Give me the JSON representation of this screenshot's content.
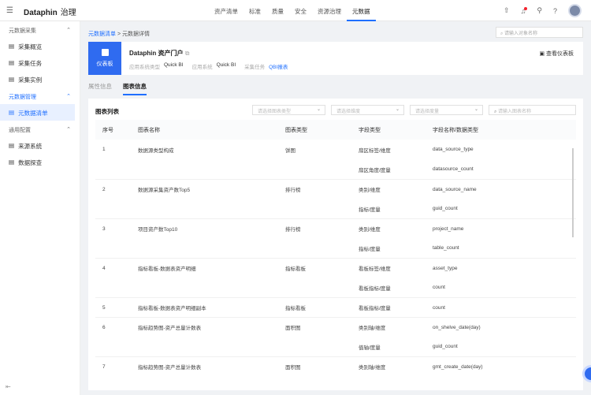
{
  "app": {
    "brand": "Dataphin",
    "module": "治理"
  },
  "nav": [
    "资产清单",
    "标准",
    "质量",
    "安全",
    "资源治理",
    "元数据"
  ],
  "nav_active": 5,
  "sidebar": [
    {
      "type": "group",
      "label": "元数据采集"
    },
    {
      "type": "item",
      "label": "采集概览",
      "icon": "overview-icon"
    },
    {
      "type": "item",
      "label": "采集任务",
      "icon": "task-icon"
    },
    {
      "type": "item",
      "label": "采集实例",
      "icon": "instance-icon"
    },
    {
      "type": "group",
      "label": "元数据管理",
      "active": true
    },
    {
      "type": "item",
      "label": "元数据清单",
      "icon": "list-icon",
      "active": true
    },
    {
      "type": "group",
      "label": "通用配置"
    },
    {
      "type": "item",
      "label": "来源系统",
      "icon": "source-icon"
    },
    {
      "type": "item",
      "label": "数据探查",
      "icon": "explore-icon"
    }
  ],
  "breadcrumb": [
    "元数据清单",
    "元数据详情"
  ],
  "global_search": {
    "placeholder": "请输入对象名称"
  },
  "asset": {
    "badge": "仪表板",
    "title": "Dataphin 资产门户",
    "meta": [
      {
        "k": "应用系统类型",
        "v": "Quick BI"
      },
      {
        "k": "应用系统",
        "v": "Quick BI"
      },
      {
        "k": "采集任务",
        "v": "QBI报表"
      }
    ],
    "view_button": "查看仪表板"
  },
  "tabs": [
    "属性信息",
    "图表信息"
  ],
  "tab_active": 1,
  "chart_list": {
    "title": "图表列表",
    "filters": [
      "请选择图表类型",
      "请选择维度",
      "请选择度量"
    ],
    "search_placeholder": "请输入图表名称",
    "columns": [
      "序号",
      "图表名称",
      "图表类型",
      "字段类型",
      "字段名称/数据类型"
    ],
    "rows": [
      {
        "no": "1",
        "name": "数据源类型构成",
        "type": "饼图",
        "field_type": "扇区标签/维度",
        "field": "data_source_type"
      },
      {
        "no": "",
        "name": "",
        "type": "",
        "field_type": "扇区角度/度量",
        "field": "datasource_count"
      },
      {
        "no": "2",
        "name": "数据源采集资产数Top5",
        "type": "排行榜",
        "field_type": "类别/维度",
        "field": "data_source_name"
      },
      {
        "no": "",
        "name": "",
        "type": "",
        "field_type": "指标/度量",
        "field": "guid_count"
      },
      {
        "no": "3",
        "name": "项目资产数Top10",
        "type": "排行榜",
        "field_type": "类别/维度",
        "field": "project_name"
      },
      {
        "no": "",
        "name": "",
        "type": "",
        "field_type": "指标/度量",
        "field": "table_count"
      },
      {
        "no": "4",
        "name": "指标看板-数据表资产明细",
        "type": "指标看板",
        "field_type": "看板标签/维度",
        "field": "asset_type"
      },
      {
        "no": "",
        "name": "",
        "type": "",
        "field_type": "看板指标/度量",
        "field": "count"
      },
      {
        "no": "5",
        "name": "指标看板-数据表资产明细副本",
        "type": "指标看板",
        "field_type": "看板指标/度量",
        "field": "count"
      },
      {
        "no": "6",
        "name": "指标趋势图-资产总量计数表",
        "type": "面积图",
        "field_type": "类别轴/维度",
        "field": "on_shelve_date(day)"
      },
      {
        "no": "",
        "name": "",
        "type": "",
        "field_type": "值轴/度量",
        "field": "guid_count"
      },
      {
        "no": "7",
        "name": "指标趋势图-资产总量计数表",
        "type": "面积图",
        "field_type": "类别轴/维度",
        "field": "gmt_create_date(day)"
      }
    ]
  },
  "colors": {
    "accent": "#1f6fff",
    "badge": "#2f6bf0"
  }
}
